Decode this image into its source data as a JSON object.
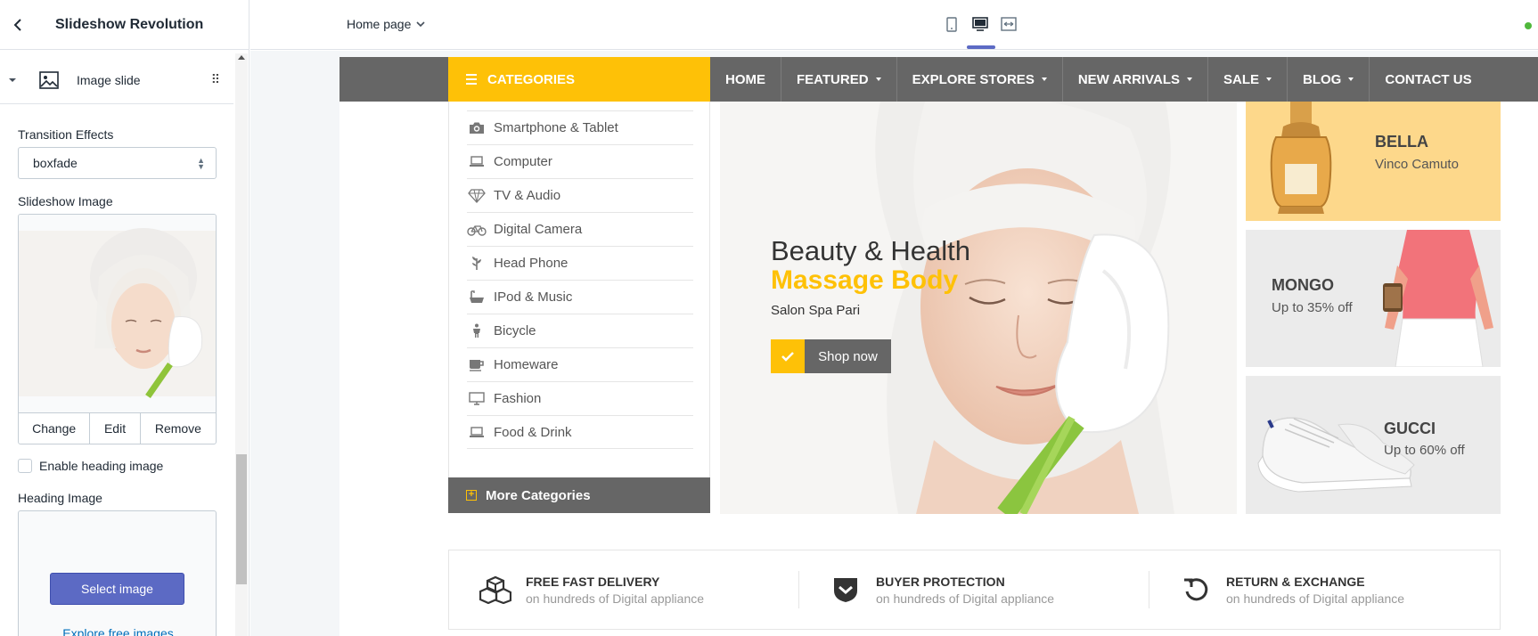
{
  "panel": {
    "title": "Slideshow Revolution",
    "block_label": "Image slide",
    "transition_label": "Transition Effects",
    "transition_value": "boxfade",
    "slideshow_image_label": "Slideshow Image",
    "buttons": {
      "change": "Change",
      "edit": "Edit",
      "remove": "Remove"
    },
    "enable_heading_label": "Enable heading image",
    "heading_image_label": "Heading Image",
    "select_image": "Select image",
    "explore_link": "Explore free images"
  },
  "topbar": {
    "page_select": "Home page"
  },
  "store": {
    "categories_label": "CATEGORIES",
    "nav": [
      {
        "label": "HOME",
        "dropdown": false
      },
      {
        "label": "FEATURED",
        "dropdown": true
      },
      {
        "label": "EXPLORE STORES",
        "dropdown": true
      },
      {
        "label": "NEW ARRIVALS",
        "dropdown": true
      },
      {
        "label": "SALE",
        "dropdown": true
      },
      {
        "label": "BLOG",
        "dropdown": true
      },
      {
        "label": "CONTACT US",
        "dropdown": false
      }
    ],
    "categories": [
      {
        "label": "Smartphone & Tablet",
        "icon": "camera-icon"
      },
      {
        "label": "Computer",
        "icon": "laptop-icon"
      },
      {
        "label": "TV & Audio",
        "icon": "diamond-icon"
      },
      {
        "label": "Digital Camera",
        "icon": "bicycle-icon"
      },
      {
        "label": "Head Phone",
        "icon": "plant-icon"
      },
      {
        "label": "IPod & Music",
        "icon": "bathtub-icon"
      },
      {
        "label": "Bicycle",
        "icon": "child-icon"
      },
      {
        "label": "Homeware",
        "icon": "coffee-icon"
      },
      {
        "label": "Fashion",
        "icon": "monitor-icon"
      },
      {
        "label": "Food & Drink",
        "icon": "laptop-icon"
      }
    ],
    "more_categories": "More Categories",
    "hero": {
      "line1": "Beauty & Health",
      "line2": "Massage Body",
      "line3": "Salon Spa Pari",
      "button": "Shop now"
    },
    "banners": [
      {
        "title": "BELLA",
        "subtitle": "Vinco Camuto",
        "bg": "#fdd88b"
      },
      {
        "title": "MONGO",
        "subtitle": "Up to 35% off",
        "bg": "#ebebeb"
      },
      {
        "title": "GUCCI",
        "subtitle": "Up to 60% off",
        "bg": "#ebebeb"
      }
    ],
    "services": [
      {
        "title": "FREE FAST DELIVERY",
        "subtitle": "on hundreds of Digital appliance",
        "icon": "boxes-icon"
      },
      {
        "title": "BUYER PROTECTION",
        "subtitle": "on hundreds of Digital appliance",
        "icon": "shield-icon"
      },
      {
        "title": "RETURN & EXCHANGE",
        "subtitle": "on hundreds of Digital appliance",
        "icon": "return-icon"
      }
    ]
  },
  "colors": {
    "accent": "#fec107",
    "nav_bg": "#666666",
    "primary_button": "#5c6ac4",
    "link": "#006fbb"
  }
}
